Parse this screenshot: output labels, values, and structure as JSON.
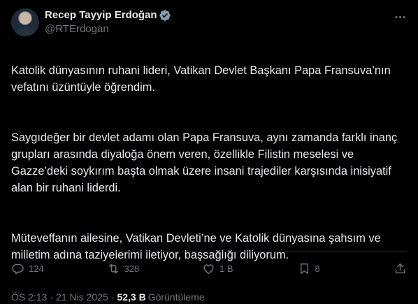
{
  "author": {
    "display_name": "Recep Tayyip Erdoğan",
    "handle": "@RTErdogan",
    "verified": true,
    "verified_color": "#829aab"
  },
  "tweet": {
    "paragraphs": [
      "Katolik dünyasının ruhani lideri, Vatikan Devlet Başkanı Papa Fransuva’nın vefatını üzüntüyle öğrendim.",
      "Saygıdeğer bir devlet adamı olan Papa Fransuva, aynı zamanda farklı inanç grupları arasında diyaloğa önem veren, özellikle Filistin meselesi ve Gazze’deki soykırım başta olmak üzere insani trajediler karşısında inisiyatif alan bir ruhani liderdi.",
      "Müteveffanın ailesine, Vatikan Devleti’ne ve Katolik dünyasına şahsım ve milletim adına taziyelerimi iletiyor, başsağlığı diliyorum."
    ],
    "time": "ÖS 2:13",
    "date": "21 Nis 2025",
    "separator": "·",
    "views_count": "52,3 B",
    "views_label": "Görüntüleme"
  },
  "actions": {
    "reply_count": "124",
    "retweet_count": "328",
    "like_count": "1 B",
    "bookmark_count": "8",
    "icons": [
      "reply-icon",
      "retweet-icon",
      "like-icon",
      "bookmark-icon",
      "share-icon"
    ]
  },
  "colors": {
    "background": "#000000",
    "text": "#e7e9ea",
    "muted": "#71767b",
    "divider": "#2f3336"
  }
}
